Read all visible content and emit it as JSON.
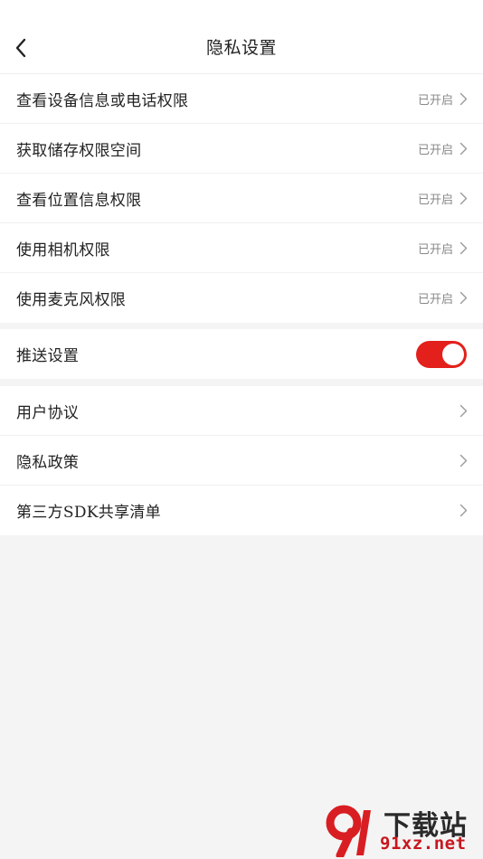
{
  "header": {
    "title": "隐私设置",
    "back_icon": "chevron-left-icon"
  },
  "permissions": [
    {
      "label": "查看设备信息或电话权限",
      "status": "已开启"
    },
    {
      "label": "获取储存权限空间",
      "status": "已开启"
    },
    {
      "label": "查看位置信息权限",
      "status": "已开启"
    },
    {
      "label": "使用相机权限",
      "status": "已开启"
    },
    {
      "label": "使用麦克风权限",
      "status": "已开启"
    }
  ],
  "push": {
    "label": "推送设置",
    "enabled": true,
    "toggle_color": "#e3201b"
  },
  "legal": [
    {
      "label": "用户协议"
    },
    {
      "label": "隐私政策"
    },
    {
      "label": "第三方SDK共享清单"
    }
  ],
  "watermark": {
    "top": "下载站",
    "bottom": "91xz.net"
  }
}
